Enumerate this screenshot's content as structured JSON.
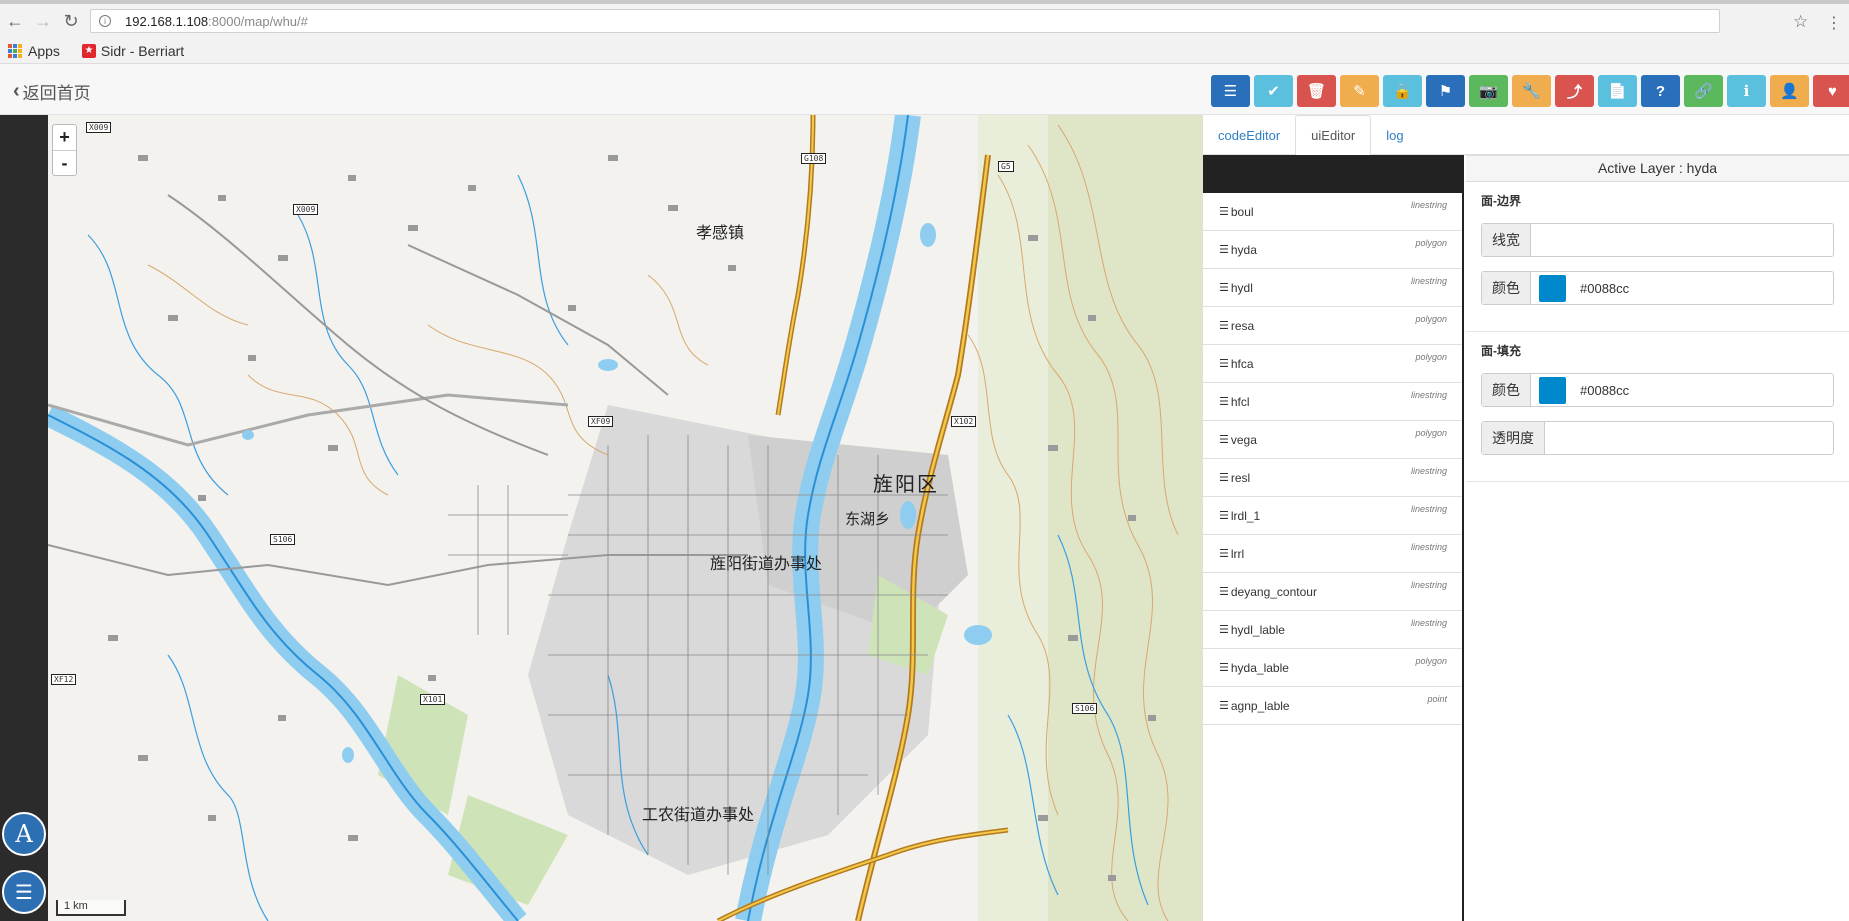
{
  "browser": {
    "url_host": "192.168.1.108",
    "url_path": ":8000/map/whu/#",
    "bookmarks": [
      "Apps",
      "Sidr - Berriart"
    ]
  },
  "header": {
    "back_label": "返回首页",
    "toolbar": [
      {
        "icon": "list-icon",
        "color": "#2a6fba"
      },
      {
        "icon": "check-icon",
        "color": "#5bc0de"
      },
      {
        "icon": "trash-icon",
        "color": "#d9534f"
      },
      {
        "icon": "pencil-icon",
        "color": "#f0ad4e"
      },
      {
        "icon": "lock-icon",
        "color": "#5bc0de"
      },
      {
        "icon": "flag-icon",
        "color": "#2a6fba"
      },
      {
        "icon": "camera-icon",
        "color": "#5cb85c"
      },
      {
        "icon": "wrench-icon",
        "color": "#f0ad4e"
      },
      {
        "icon": "share-icon",
        "color": "#d9534f"
      },
      {
        "icon": "document-icon",
        "color": "#5bc0de"
      },
      {
        "icon": "question-icon",
        "color": "#2a6fba"
      },
      {
        "icon": "link-icon",
        "color": "#5cb85c"
      },
      {
        "icon": "info-icon",
        "color": "#5bc0de"
      },
      {
        "icon": "user-icon",
        "color": "#f0ad4e"
      },
      {
        "icon": "heart-icon",
        "color": "#d9534f"
      }
    ]
  },
  "map": {
    "zoom_in": "+",
    "zoom_out": "-",
    "scale": "1 km",
    "labels": {
      "xiaogan": "孝感镇",
      "jingyang_qu": "旌阳区",
      "donghu": "东湖乡",
      "jingyang_jd": "旌阳街道办事处",
      "gongnong": "工农街道办事处"
    },
    "shields": [
      "G108",
      "G5",
      "X102",
      "XF09",
      "S106",
      "X101",
      "XF12",
      "S106",
      "X009",
      "X009"
    ]
  },
  "sidebar": {
    "a_label": "A"
  },
  "panel": {
    "tabs": [
      "codeEditor",
      "uiEditor",
      "log"
    ],
    "active_tab": "uiEditor",
    "layers": [
      {
        "name": "boul",
        "type": "linestring"
      },
      {
        "name": "hyda",
        "type": "polygon"
      },
      {
        "name": "hydl",
        "type": "linestring"
      },
      {
        "name": "resa",
        "type": "polygon"
      },
      {
        "name": "hfca",
        "type": "polygon"
      },
      {
        "name": "hfcl",
        "type": "linestring"
      },
      {
        "name": "vega",
        "type": "polygon"
      },
      {
        "name": "resl",
        "type": "linestring"
      },
      {
        "name": "lrdl_1",
        "type": "linestring"
      },
      {
        "name": "lrrl",
        "type": "linestring"
      },
      {
        "name": "deyang_contour",
        "type": "linestring"
      },
      {
        "name": "hydl_lable",
        "type": "linestring"
      },
      {
        "name": "hyda_lable",
        "type": "polygon"
      },
      {
        "name": "agnp_lable",
        "type": "point"
      }
    ],
    "active_layer": "Active Layer : hyda",
    "border_section": {
      "title": "面-边界",
      "width_label": "线宽",
      "width_value": "",
      "color_label": "颜色",
      "color_value": "#0088cc"
    },
    "fill_section": {
      "title": "面-填充",
      "color_label": "颜色",
      "color_value": "#0088cc",
      "opacity_label": "透明度",
      "opacity_value": ""
    }
  }
}
